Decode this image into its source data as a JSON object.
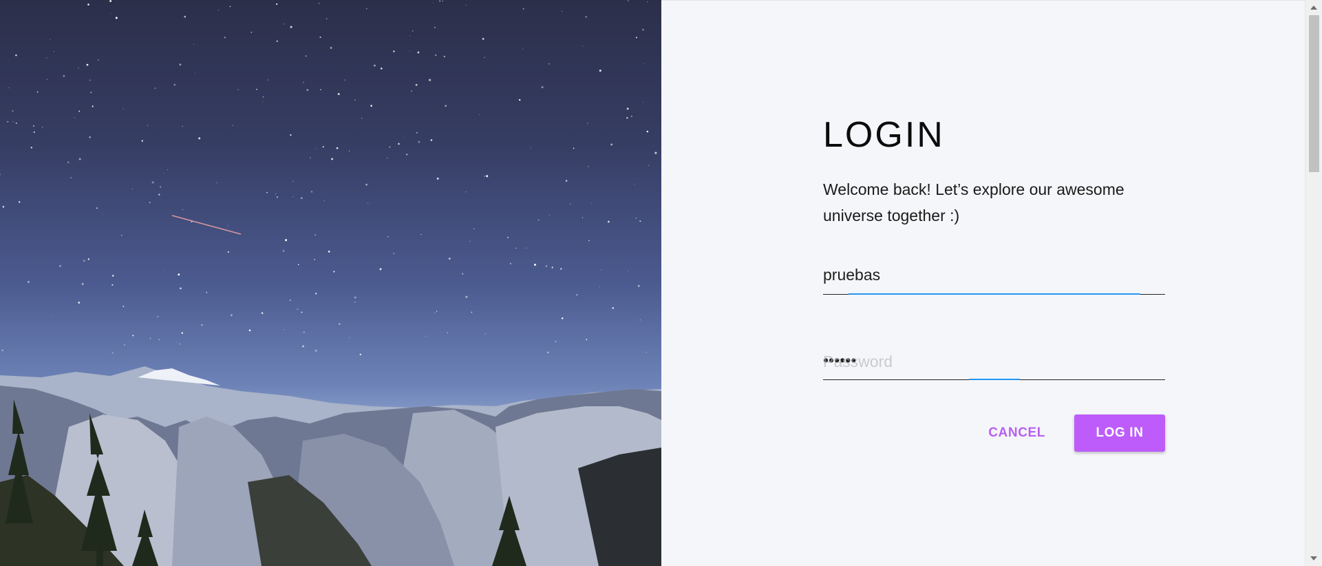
{
  "hero": {
    "image": "starry-mountain-night-landscape"
  },
  "login": {
    "title": "LOGIN",
    "welcome": "Welcome back! Let’s explore our awesome universe together :)",
    "username": {
      "value": "pruebas"
    },
    "password": {
      "value": "••••••",
      "placeholder": "Password"
    },
    "cancel_label": "CANCEL",
    "login_label": "LOG IN"
  },
  "colors": {
    "accent": "#bd5cfa",
    "focus_underline": "#2196f3",
    "background": "#f5f6fa"
  },
  "icons": {
    "scroll_up": "chevron-up-icon",
    "scroll_down": "chevron-down-icon"
  }
}
